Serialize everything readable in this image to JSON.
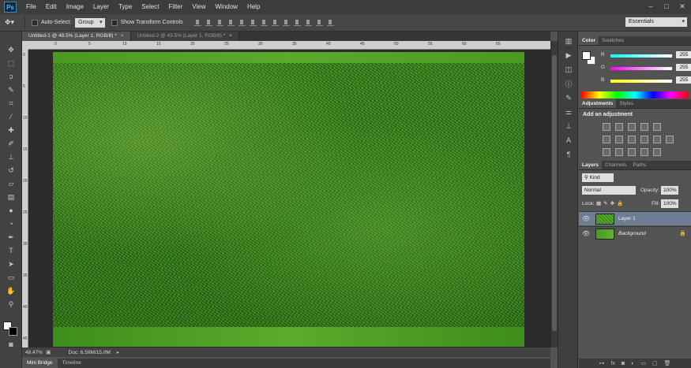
{
  "menubar": {
    "logo": "Ps",
    "items": [
      "File",
      "Edit",
      "Image",
      "Layer",
      "Type",
      "Select",
      "Filter",
      "View",
      "Window",
      "Help"
    ],
    "window_controls": [
      "–",
      "□",
      "✕"
    ]
  },
  "options": {
    "auto_select_label": "Auto-Select:",
    "auto_select_value": "Group",
    "transform_label": "Show Transform Controls",
    "workspace": "Essentials"
  },
  "tabs": [
    {
      "label": "Untitled-1 @ 48.5% (Layer 1, RGB/8) *",
      "close": "×"
    },
    {
      "label": "Untitled-2 @ 43.5% (Layer 1, RGB/8) *",
      "close": "×"
    }
  ],
  "ruler": {
    "top": [
      "0",
      "5",
      "10",
      "15",
      "20",
      "25",
      "30",
      "35",
      "40",
      "45",
      "50",
      "55",
      "60",
      "65"
    ],
    "left": [
      "0",
      "5",
      "10",
      "15",
      "20",
      "25",
      "30",
      "35",
      "40",
      "45"
    ]
  },
  "status": {
    "zoom": "48.47%",
    "doc": "Doc: 6.59M/15.0M"
  },
  "bottom_tabs": [
    "Mini Bridge",
    "Timeline"
  ],
  "color_panel": {
    "tabs": [
      "Color",
      "Swatches"
    ],
    "r_label": "R",
    "g_label": "G",
    "b_label": "B",
    "r": "255",
    "g": "255",
    "b": "255"
  },
  "adjustments": {
    "tabs": [
      "Adjustments",
      "Styles"
    ],
    "title": "Add an adjustment"
  },
  "layers": {
    "tabs": [
      "Layers",
      "Channels",
      "Paths"
    ],
    "kind": "Kind",
    "blend": "Normal",
    "opacity_label": "Opacity:",
    "opacity": "100%",
    "lock_label": "Lock:",
    "fill_label": "Fill:",
    "fill": "100%",
    "items": [
      {
        "name": "Layer 1",
        "selected": true
      },
      {
        "name": "Background",
        "selected": false
      }
    ]
  },
  "colors": {
    "grass_dark": "#327a1a",
    "grass_light": "#5aab2a",
    "selected_layer": "#6f7d92"
  }
}
